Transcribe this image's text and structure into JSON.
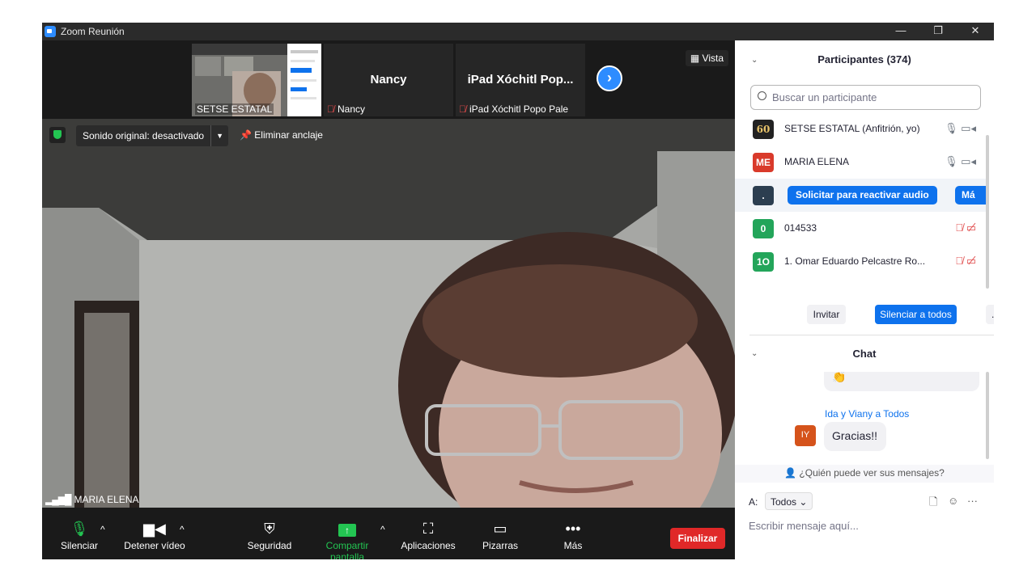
{
  "window": {
    "title": "Zoom Reunión",
    "minimize": "—",
    "restore": "❐",
    "close": "✕"
  },
  "filmstrip": {
    "tiles": [
      {
        "name": "SETSE ESTATAL"
      },
      {
        "big_name": "Nancy",
        "name": "Nancy"
      },
      {
        "big_name": "iPad Xóchitl Pop...",
        "name": "iPad Xóchitl Popo Pale"
      }
    ],
    "view_label": "Vista"
  },
  "video": {
    "original_sound": "Sonido original: desactivado",
    "unpin": "Eliminar anclaje",
    "speaker": "MARIA ELENA"
  },
  "toolbar": {
    "mute": "Silenciar",
    "stop_video": "Detener vídeo",
    "security": "Seguridad",
    "share": "Compartir pantalla",
    "apps": "Aplicaciones",
    "whiteboards": "Pizarras",
    "more": "Más",
    "end": "Finalizar"
  },
  "participants": {
    "title": "Participantes (374)",
    "search_placeholder": "Buscar un participante",
    "list": [
      {
        "name": "SETSE ESTATAL (Anfitrión, yo)",
        "avatar": "60",
        "color": "#222222"
      },
      {
        "name": "MARIA ELENA",
        "avatar": "ME",
        "color": "#d93a2b"
      },
      {
        "name": "",
        "avatar": ".",
        "color": "#2c3e50"
      },
      {
        "name": "014533",
        "avatar": "0",
        "color": "#23a55a"
      },
      {
        "name": "1. Omar Eduardo Pelcastre Ro...",
        "avatar": "1O",
        "color": "#23a55a"
      }
    ],
    "request_unmute": "Solicitar para reactivar audio",
    "more_short": "Má",
    "invite": "Invitar",
    "mute_all": "Silenciar a todos",
    "more_dots": "..."
  },
  "chat": {
    "title": "Chat",
    "emoji_bubble": "👏",
    "sender": "Ida y Viany a Todos",
    "sender_avatar": "IY",
    "message": "Gracias!!",
    "who_sees": "¿Quién puede ver sus mensajes?",
    "to_label": "A:",
    "to_value": "Todos",
    "placeholder": "Escribir mensaje aquí..."
  },
  "colors": {
    "accent": "#0e72ed",
    "end_red": "#e02828",
    "share_green": "#23c552"
  }
}
